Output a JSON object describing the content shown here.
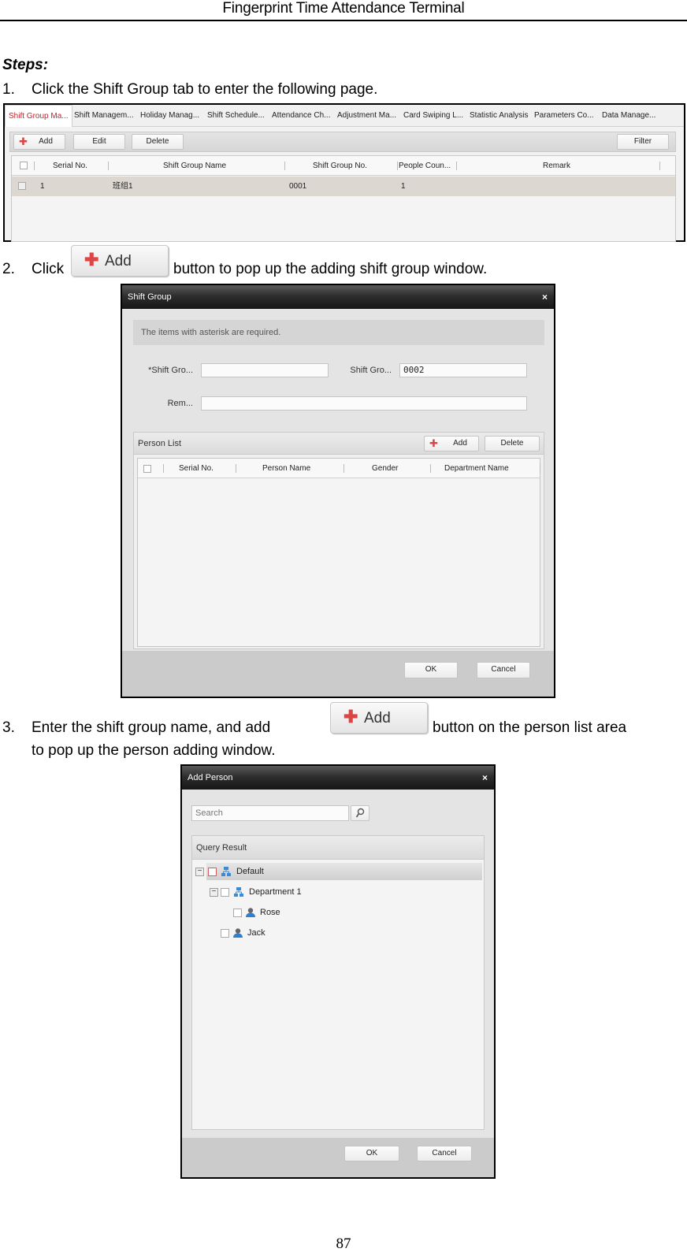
{
  "header": {
    "title": "Fingerprint Time Attendance Terminal"
  },
  "steps_label": "Steps:",
  "steps": [
    {
      "num": "1.",
      "text": "Click the Shift Group tab to enter the following page."
    },
    {
      "num": "2.",
      "before": "Click",
      "after": "button to pop up the adding shift group window.",
      "button_label": "Add"
    },
    {
      "num": "3.",
      "before": "Enter the shift group name, and add",
      "after": "button on the person list area",
      "line2": "to pop up the person adding window.",
      "button_label": "Add"
    }
  ],
  "shift_group_page": {
    "tabs": [
      {
        "label": "Shift Group Ma...",
        "active": true
      },
      {
        "label": "Shift Managem..."
      },
      {
        "label": "Holiday Manag..."
      },
      {
        "label": "Shift Schedule..."
      },
      {
        "label": "Attendance Ch..."
      },
      {
        "label": "Adjustment Ma..."
      },
      {
        "label": "Card Swiping L..."
      },
      {
        "label": "Statistic Analysis"
      },
      {
        "label": "Parameters Co..."
      },
      {
        "label": "Data Manage..."
      }
    ],
    "toolbar": {
      "add": "Add",
      "edit": "Edit",
      "delete": "Delete",
      "filter": "Filter"
    },
    "columns": [
      "Serial No.",
      "Shift Group Name",
      "Shift Group No.",
      "People Coun...",
      "Remark"
    ],
    "rows": [
      {
        "serial": "1",
        "name": "班组1",
        "group_no": "0001",
        "people": "1",
        "remark": ""
      }
    ]
  },
  "shift_group_dialog": {
    "title": "Shift Group",
    "close": "×",
    "notice": "The items with asterisk are required.",
    "name_label": "*Shift Gro...",
    "name_value": "",
    "no_label": "Shift Gro...",
    "no_value": "0002",
    "remark_label": "Rem...",
    "remark_value": "",
    "person_list": {
      "title": "Person List",
      "add": "Add",
      "delete": "Delete",
      "columns": [
        "Serial No.",
        "Person Name",
        "Gender",
        "Department Name"
      ]
    },
    "ok": "OK",
    "cancel": "Cancel"
  },
  "add_person_dialog": {
    "title": "Add Person",
    "close": "×",
    "search_placeholder": "Search",
    "query_result": "Query Result",
    "tree": [
      {
        "label": "Default",
        "type": "org"
      },
      {
        "label": "Department 1",
        "type": "org"
      },
      {
        "label": "Rose",
        "type": "person"
      },
      {
        "label": "Jack",
        "type": "person"
      }
    ],
    "ok": "OK",
    "cancel": "Cancel"
  },
  "page_number": "87"
}
